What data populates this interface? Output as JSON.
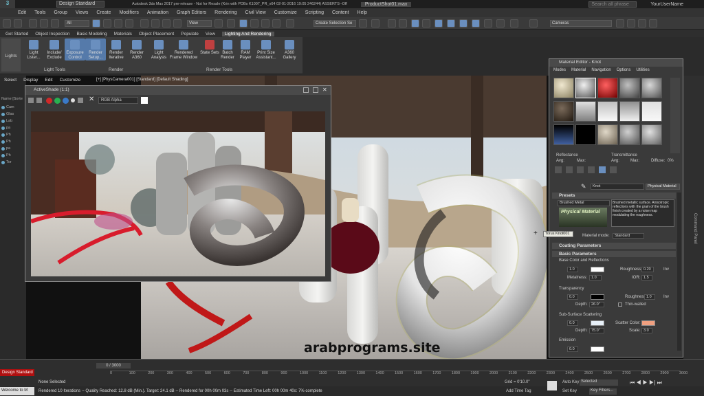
{
  "titlebar": {
    "workspace": "Design Standard",
    "title": "Autodesk 3ds Max 2017 pre-release - Not for Resale (Krin with PDBs K1007_PR_x64 02-01-2016 19:05 246244) ASSERTS--Off",
    "file_tab": "ProductShot01.max",
    "search_placeholder": "Search all phrase",
    "user": "YourUserName"
  },
  "menu": [
    "Edit",
    "Tools",
    "Group",
    "Views",
    "Create",
    "Modifiers",
    "Animation",
    "Graph Editors",
    "Rendering",
    "Civil View",
    "Customize",
    "Scripting",
    "Content",
    "Help"
  ],
  "toolbar": {
    "filter": "All",
    "view": "View",
    "selection_set": "Create Selection Se",
    "camera": "Cameras"
  },
  "ribbon_tabs": [
    "Get Started",
    "Object Inspection",
    "Basic Modeling",
    "Materials",
    "Object Placement",
    "Populate",
    "View",
    "Lighting And Rendering"
  ],
  "ribbon": {
    "lights": "Lights",
    "buttons": [
      {
        "label": "Light Lister...",
        "group": "Light Tools"
      },
      {
        "label": "Include/ Exclude",
        "group": "Light Tools"
      },
      {
        "label": "Exposure Control",
        "group": "Light Tools"
      },
      {
        "label": "Render Setup...",
        "group": "Render"
      },
      {
        "label": "Render Iterative",
        "group": "Render"
      },
      {
        "label": "Render A360",
        "group": "Render"
      },
      {
        "label": "Light Analysis",
        "group": "Render Tools"
      },
      {
        "label": "Rendered Frame Window",
        "group": "Render Tools"
      },
      {
        "label": "State Sets",
        "group": "Render Tools"
      },
      {
        "label": "Batch Render",
        "group": "Render Tools"
      },
      {
        "label": "RAM Player",
        "group": "Render Tools"
      },
      {
        "label": "Print Size Assistant...",
        "group": "Render Tools"
      },
      {
        "label": "A360 Gallery",
        "group": "Render Tools"
      }
    ],
    "groups": [
      "Light Tools",
      "Render",
      "Render Tools"
    ]
  },
  "scene_explorer": {
    "menu": [
      "Select",
      "Display",
      "Edit",
      "Customize"
    ],
    "header": "Name [Sorte",
    "rows": [
      "Cam",
      "Glas",
      "Lab",
      "pa",
      "Ph",
      "Ph",
      "pa",
      "Ph",
      "Tor"
    ]
  },
  "viewport": {
    "label": "[+] [PhysCamera001] [Standard] [Default Shading]"
  },
  "activeshade": {
    "title": "ActiveShade (1:1)",
    "channel": "RGB Alpha"
  },
  "material_editor": {
    "title": "Material Editor - Knot",
    "menu": [
      "Modes",
      "Material",
      "Navigation",
      "Options",
      "Utilities"
    ],
    "reflectance": "Reflectance",
    "transmittance": "Transmittance",
    "avg": "Avg:",
    "max": "Max:",
    "diffuse": "Diffuse:",
    "diffuse_val": "0%",
    "material_name": "Knot",
    "material_type": "Physical Material",
    "presets_title": "Presets",
    "preset": "Brushed Metal",
    "preset_desc": "Brushed metallic surface. Anisotropic reflections with the grain of the brush finish created by a noise map modulating the roughness.",
    "logo_text": "Physical Material",
    "material_mode_label": "Material mode:",
    "material_mode": "Standard",
    "coating": "Coating Parameters",
    "basic": "Basic Parameters",
    "base_color": "Base Color and Reflections",
    "base_weight": "1.0",
    "roughness_label": "Roughness:",
    "roughness": "0.20",
    "inv": "Inv",
    "metalness_label": "Metalness:",
    "metalness": "1.0",
    "ior_label": "IOR:",
    "ior": "1.5",
    "transparency": "Transparency",
    "trans_weight": "0.0",
    "trans_roughness_label": "Roughness:",
    "trans_roughness": "1.0",
    "depth_label": "Depth:",
    "depth": "26.0\"",
    "thin_walled": "Thin-walled",
    "sss": "Sub-Surface Scattering",
    "sss_weight": "0.0",
    "scatter_label": "Scatter Color:",
    "sss_depth_label": "Depth:",
    "sss_depth": "75.0\"",
    "scale_label": "Scale:",
    "scale": "3.0",
    "emission": "Emission",
    "emission_weight": "0.0",
    "colors": {
      "base": "#ffffff",
      "trans": "#000000",
      "sss": "#e8f0f8",
      "scatter": "#f0a080",
      "emission": "#ffffff"
    }
  },
  "tooltip": "Torus Knot001",
  "command_panel_label": "Command Panel",
  "watermark": "arabprograms.site",
  "timeline": {
    "frame": "0 / 3000",
    "ticks": [
      "0",
      "100",
      "200",
      "300",
      "400",
      "500",
      "600",
      "700",
      "800",
      "900",
      "1000",
      "1100",
      "1200",
      "1300",
      "1400",
      "1500",
      "1600",
      "1700",
      "1800",
      "1900",
      "2000",
      "2100",
      "2200",
      "2300",
      "2400",
      "2500",
      "2600",
      "2700",
      "2800",
      "2900",
      "3000"
    ]
  },
  "status": {
    "workspace": "Design Standard",
    "selection": "None Selected",
    "render_info": "Rendered 10 Iterations -- Quality Reached: 12.8 dB (Min.). Target: 24.1 dB -- Rendered for 00h 00m 03s -- Estimated Time Left: 00h 00m 40s: 7% complete",
    "welcome": "Welcome to M",
    "grid": "Grid = 0'10.0\"",
    "add_time_tag": "Add Time Tag",
    "auto_key": "Auto Key",
    "set_key": "Set Key",
    "selected": "Selected",
    "key_filters": "Key Filters..."
  }
}
